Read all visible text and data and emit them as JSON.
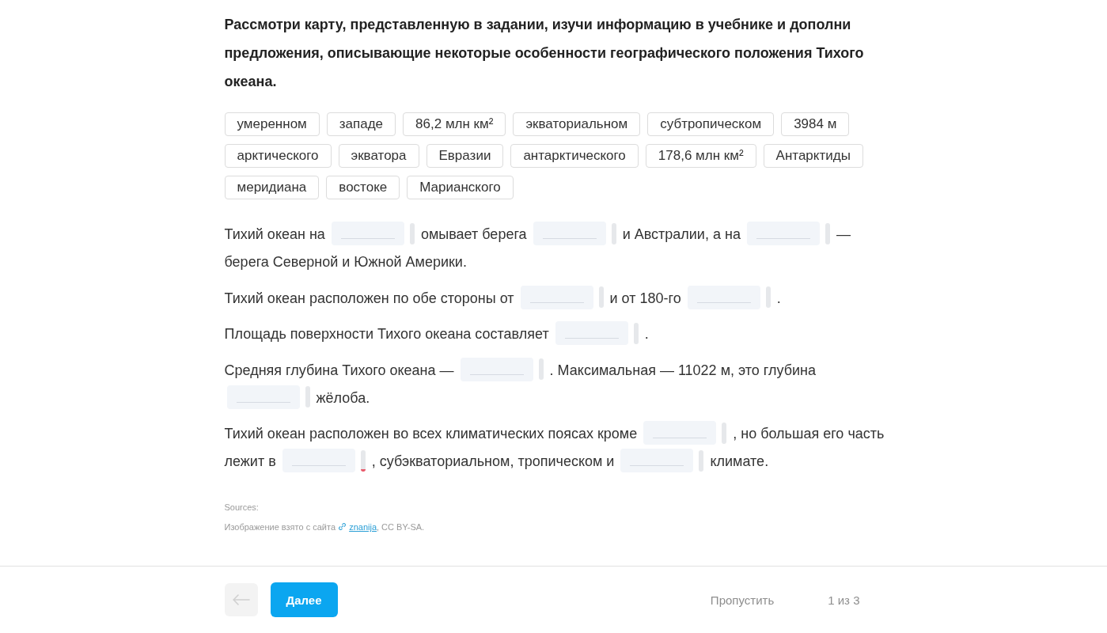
{
  "task": {
    "instruction": "Рассмотри карту, представленную в задании, изучи информацию в учебнике и дополни предложения, описывающие некоторые особенности географического положения Тихого океана."
  },
  "word_bank": [
    "умеренном",
    "западе",
    "86,2 млн км²",
    "экваториальном",
    "субтропическом",
    "3984 м",
    "арктического",
    "экватора",
    "Евразии",
    "антарктического",
    "178,6 млн км²",
    "Антарктиды",
    "меридиана",
    "востоке",
    "Марианского"
  ],
  "sentences": [
    {
      "segments": [
        {
          "kind": "text",
          "text": "Тихий океан на"
        },
        {
          "kind": "blank",
          "flagged": false
        },
        {
          "kind": "text",
          "text": "омывает берега"
        },
        {
          "kind": "blank",
          "flagged": false
        },
        {
          "kind": "text",
          "text": "и Австралии, а на"
        },
        {
          "kind": "blank",
          "flagged": false
        },
        {
          "kind": "text",
          "text": "—"
        },
        {
          "kind": "text",
          "text": "берега Северной и Южной Америки."
        }
      ]
    },
    {
      "segments": [
        {
          "kind": "text",
          "text": "Тихий океан расположен по обе стороны от"
        },
        {
          "kind": "blank",
          "flagged": false
        },
        {
          "kind": "text",
          "text": "и от 180-го"
        },
        {
          "kind": "blank",
          "flagged": false
        },
        {
          "kind": "text",
          "text": "."
        }
      ]
    },
    {
      "segments": [
        {
          "kind": "text",
          "text": "Площадь поверхности Тихого океана составляет"
        },
        {
          "kind": "blank",
          "flagged": false
        },
        {
          "kind": "text",
          "text": "."
        }
      ]
    },
    {
      "segments": [
        {
          "kind": "text",
          "text": "Средняя глубина Тихого океана —"
        },
        {
          "kind": "blank",
          "flagged": false
        },
        {
          "kind": "text",
          "text": ". Максимальная — 11022 м, это глубина"
        },
        {
          "kind": "blank",
          "flagged": false
        },
        {
          "kind": "text",
          "text": "жёлоба."
        }
      ]
    },
    {
      "segments": [
        {
          "kind": "text",
          "text": "Тихий океан расположен во всех климатических поясах кроме"
        },
        {
          "kind": "blank",
          "flagged": false
        },
        {
          "kind": "text",
          "text": ", но большая его часть"
        },
        {
          "kind": "text",
          "text": "лежит в"
        },
        {
          "kind": "blank",
          "flagged": true
        },
        {
          "kind": "text",
          "text": ", субэкваториальном, тропическом и"
        },
        {
          "kind": "blank",
          "flagged": false
        },
        {
          "kind": "text",
          "text": "климате."
        }
      ]
    }
  ],
  "sources": {
    "label": "Sources:",
    "credit_before": "Изображение взято с сайта",
    "link": "znanija",
    "credit_after": ", CC BY-SA."
  },
  "footer": {
    "back_button": {
      "disabled": true
    },
    "next_button": {
      "label": "Далее"
    },
    "skip_link": "Пропустить",
    "progress": "1 из 3"
  }
}
